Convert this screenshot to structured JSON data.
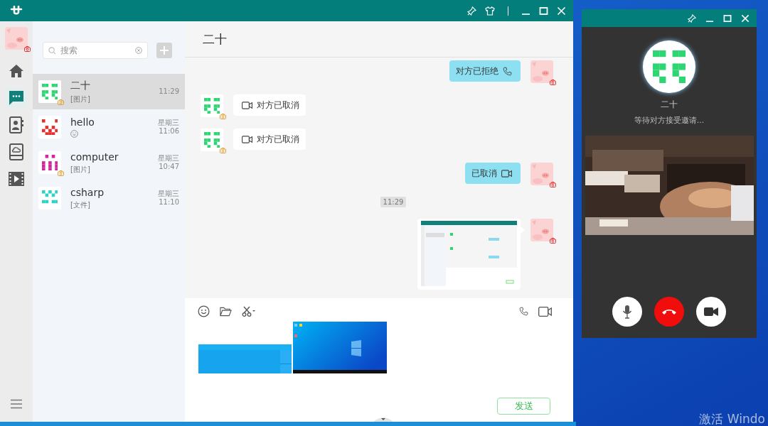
{
  "main_window": {
    "nav": [
      {
        "kind": "home",
        "selected": false
      },
      {
        "kind": "chat",
        "selected": true
      },
      {
        "kind": "contacts",
        "selected": false
      },
      {
        "kind": "cloud",
        "selected": false
      },
      {
        "kind": "video",
        "selected": false
      }
    ],
    "search": {
      "placeholder": "搜索"
    },
    "conversations": [
      {
        "name": "二十",
        "color": "#2ed573",
        "badge": true,
        "preview": {
          "kind": "text",
          "text": "[图片]"
        },
        "time": "11:29",
        "selected": true
      },
      {
        "name": "hello",
        "color": "#e03131",
        "badge": false,
        "preview": {
          "kind": "emoji"
        },
        "day": "星期三",
        "time": "11:06",
        "selected": false
      },
      {
        "name": "computer",
        "color": "#d6249f",
        "badge": true,
        "preview": {
          "kind": "text",
          "text": "[图片]"
        },
        "day": "星期三",
        "time": "10:47",
        "selected": false
      },
      {
        "name": "csharp",
        "color": "#2ed3c6",
        "badge": false,
        "preview": {
          "kind": "text",
          "text": "[文件]"
        },
        "day": "星期三",
        "time": "11:10",
        "selected": false
      }
    ],
    "chat": {
      "title": "二十",
      "messages": [
        {
          "kind": "voice_call",
          "outgoing": true,
          "text": "对方已拒绝"
        },
        {
          "kind": "video_call",
          "outgoing": false,
          "text": "对方已取消"
        },
        {
          "kind": "video_call",
          "outgoing": false,
          "text": "对方已取消"
        },
        {
          "kind": "video_call",
          "outgoing": true,
          "text": "已取消"
        },
        {
          "kind": "time",
          "text": "11:29"
        },
        {
          "kind": "picture",
          "outgoing": true
        }
      ]
    },
    "composer": {
      "attachments": [
        {
          "kind": "picture"
        },
        {
          "kind": "picture"
        }
      ],
      "send": "发送"
    }
  },
  "call_window": {
    "name": "二十",
    "status": "等待对方接受邀请...",
    "buttons": [
      {
        "kind": "mic"
      },
      {
        "kind": "hangup"
      },
      {
        "kind": "camera"
      }
    ]
  },
  "desktop": {
    "watermark": "激活 Windo"
  }
}
